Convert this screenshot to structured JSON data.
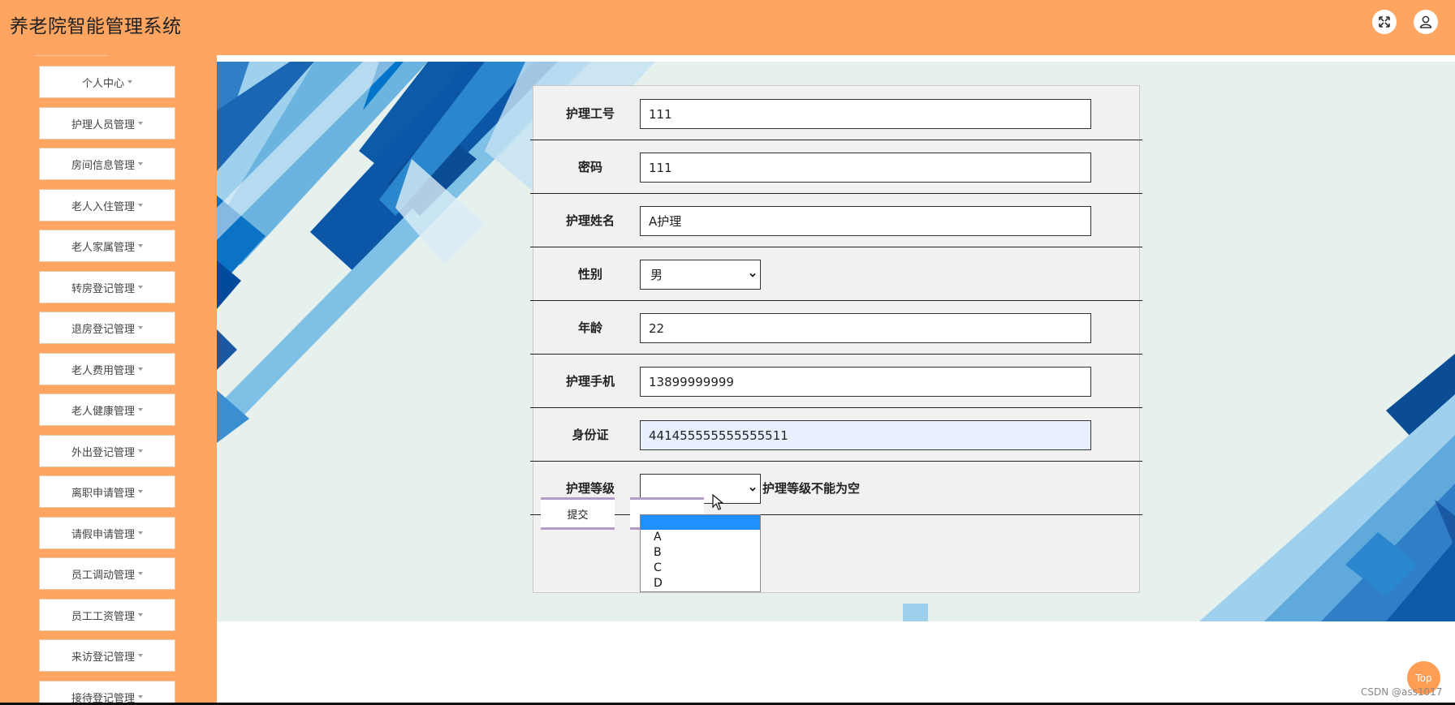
{
  "app": {
    "title": "养老院智能管理系统"
  },
  "header": {
    "fullscreen_icon": "expand-icon",
    "user_icon": "user-icon"
  },
  "sidebar": {
    "items": [
      {
        "label": "个人中心"
      },
      {
        "label": "护理人员管理"
      },
      {
        "label": "房间信息管理"
      },
      {
        "label": "老人入住管理"
      },
      {
        "label": "老人家属管理"
      },
      {
        "label": "转房登记管理"
      },
      {
        "label": "退房登记管理"
      },
      {
        "label": "老人费用管理"
      },
      {
        "label": "老人健康管理"
      },
      {
        "label": "外出登记管理"
      },
      {
        "label": "离职申请管理"
      },
      {
        "label": "请假申请管理"
      },
      {
        "label": "员工调动管理"
      },
      {
        "label": "员工工资管理"
      },
      {
        "label": "来访登记管理"
      },
      {
        "label": "接待登记管理"
      }
    ]
  },
  "form": {
    "fields": [
      {
        "label": "护理工号",
        "value": "111"
      },
      {
        "label": "密码",
        "value": "111"
      },
      {
        "label": "护理姓名",
        "value": "A护理"
      },
      {
        "label": "性别",
        "value": "男"
      },
      {
        "label": "年龄",
        "value": "22"
      },
      {
        "label": "护理手机",
        "value": "13899999999"
      },
      {
        "label": "身份证",
        "value": "441455555555555511"
      },
      {
        "label": "护理等级",
        "value": ""
      }
    ],
    "level_error": "护理等级不能为空",
    "level_options": [
      "",
      "A",
      "B",
      "C",
      "D"
    ],
    "submit_label": "提交",
    "cancel_label": ""
  },
  "footer": {
    "top_label": "Top",
    "watermark": "CSDN @ass1017"
  },
  "colors": {
    "primary": "#ffa562",
    "accent_blue": "#0a5fb4",
    "highlight": "#1e90ff"
  }
}
